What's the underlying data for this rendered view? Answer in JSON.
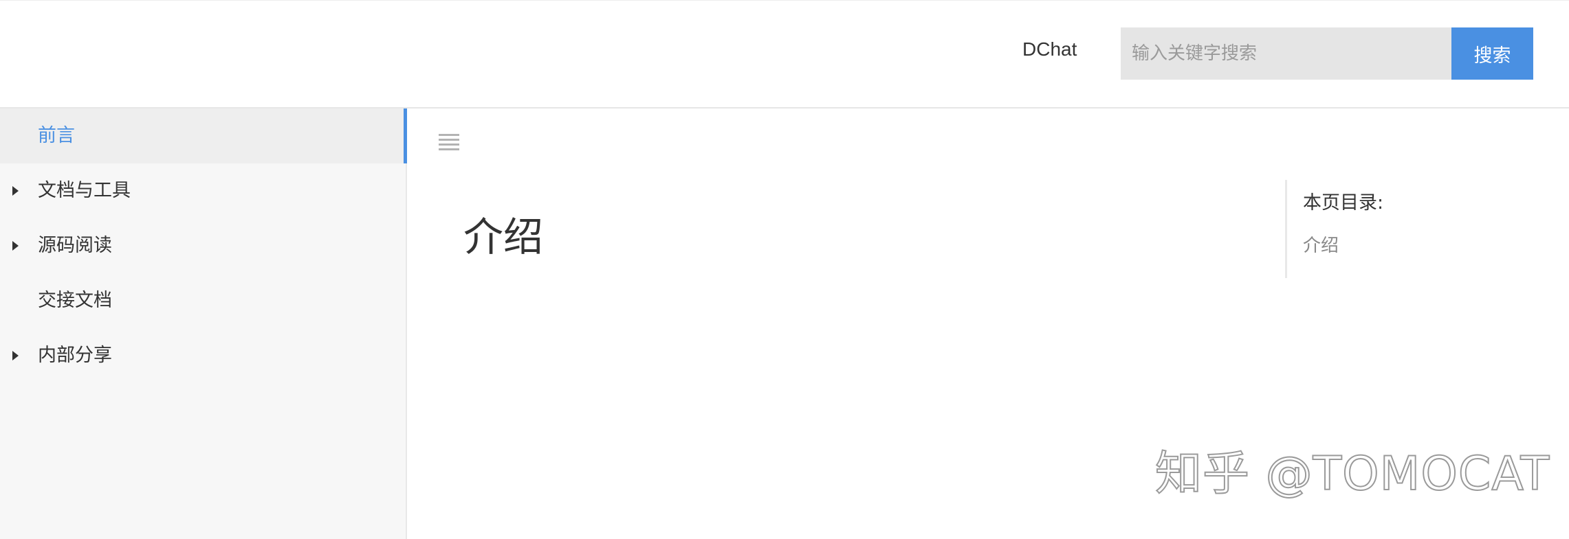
{
  "header": {
    "brand": "DChat",
    "search": {
      "placeholder": "输入关键字搜索",
      "value": "",
      "button_label": "搜索"
    }
  },
  "sidebar": {
    "items": [
      {
        "label": "前言",
        "active": true,
        "expandable": false
      },
      {
        "label": "文档与工具",
        "active": false,
        "expandable": true
      },
      {
        "label": "源码阅读",
        "active": false,
        "expandable": true
      },
      {
        "label": "交接文档",
        "active": false,
        "expandable": false
      },
      {
        "label": "内部分享",
        "active": false,
        "expandable": true
      }
    ]
  },
  "main": {
    "menu_icon": "hamburger-menu-icon",
    "title": "介绍"
  },
  "toc": {
    "title": "本页目录:",
    "links": [
      "介绍"
    ]
  },
  "watermark": "知乎 @TOMOCAT",
  "colors": {
    "accent": "#4a90e2",
    "sidebar_bg": "#f7f7f7",
    "active_item_bg": "#eeeeee",
    "search_bg": "#e5e5e5"
  }
}
